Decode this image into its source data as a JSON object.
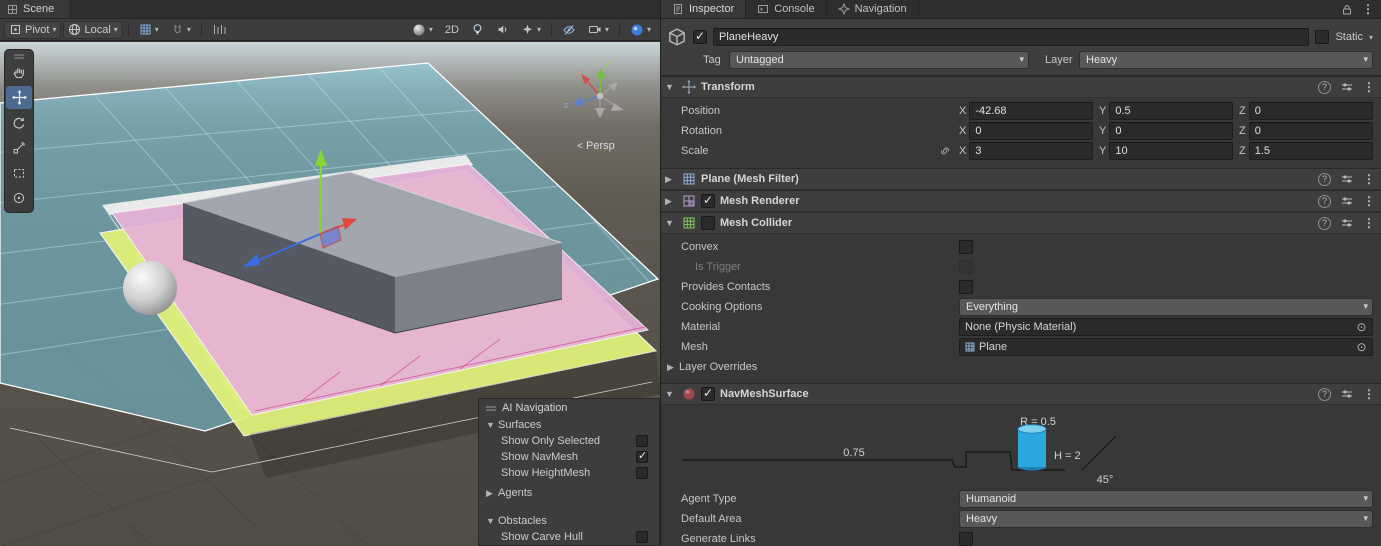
{
  "scene": {
    "tab_label": "Scene",
    "toolbar": {
      "pivot_label": "Pivot",
      "local_label": "Local",
      "two_d_label": "2D"
    },
    "view": {
      "projection_label": "Persp",
      "axis_x": "x",
      "axis_y": "y",
      "axis_z": "z"
    },
    "nav_overlay": {
      "title": "AI Navigation",
      "surfaces": {
        "label": "Surfaces",
        "items": [
          {
            "label": "Show Only Selected",
            "checked": false
          },
          {
            "label": "Show NavMesh",
            "checked": true
          },
          {
            "label": "Show HeightMesh",
            "checked": false
          }
        ]
      },
      "agents": {
        "label": "Agents"
      },
      "obstacles": {
        "label": "Obstacles",
        "items": [
          {
            "label": "Show Carve Hull",
            "checked": false
          }
        ]
      }
    }
  },
  "inspector": {
    "tabs": [
      {
        "label": "Inspector"
      },
      {
        "label": "Console"
      },
      {
        "label": "Navigation"
      }
    ],
    "game_object": {
      "name": "PlaneHeavy",
      "active": true,
      "static_label": "Static",
      "static_checked": false,
      "tag_label": "Tag",
      "tag": "Untagged",
      "layer_label": "Layer",
      "layer": "Heavy"
    },
    "axes": {
      "x": "X",
      "y": "Y",
      "z": "Z"
    },
    "transform": {
      "title": "Transform",
      "position": {
        "label": "Position",
        "x": "-42.68",
        "y": "0.5",
        "z": "0"
      },
      "rotation": {
        "label": "Rotation",
        "x": "0",
        "y": "0",
        "z": "0"
      },
      "scale": {
        "label": "Scale",
        "x": "3",
        "y": "10",
        "z": "1.5"
      }
    },
    "mesh_filter": {
      "title": "Plane (Mesh Filter)"
    },
    "mesh_renderer": {
      "title": "Mesh Renderer",
      "enabled": true
    },
    "mesh_collider": {
      "title": "Mesh Collider",
      "enabled": false,
      "convex_label": "Convex",
      "convex": false,
      "is_trigger_label": "Is Trigger",
      "is_trigger": false,
      "provides_contacts_label": "Provides Contacts",
      "provides_contacts": false,
      "cooking_options_label": "Cooking Options",
      "cooking_options": "Everything",
      "material_label": "Material",
      "material": "None (Physic Material)",
      "mesh_label": "Mesh",
      "mesh": "Plane",
      "layer_overrides_label": "Layer Overrides"
    },
    "navmesh_surface": {
      "title": "NavMeshSurface",
      "enabled": true,
      "diagram": {
        "radius_label": "R = 0.5",
        "height_label": "H = 2",
        "step_label": "0.75",
        "slope_label": "45°"
      },
      "agent_type_label": "Agent Type",
      "agent_type": "Humanoid",
      "default_area_label": "Default Area",
      "default_area": "Heavy",
      "generate_links_label": "Generate Links",
      "generate_links": false
    }
  },
  "colors": {
    "selection_blue": "#4d6b90",
    "navmesh_cyan": "#7dd2eb",
    "navmesh_pink": "#e7b3d8",
    "navmesh_lime": "#dff07a",
    "agent_cylinder": "#2ba7dd",
    "gizmo_blue_button": "#3e7de0"
  }
}
